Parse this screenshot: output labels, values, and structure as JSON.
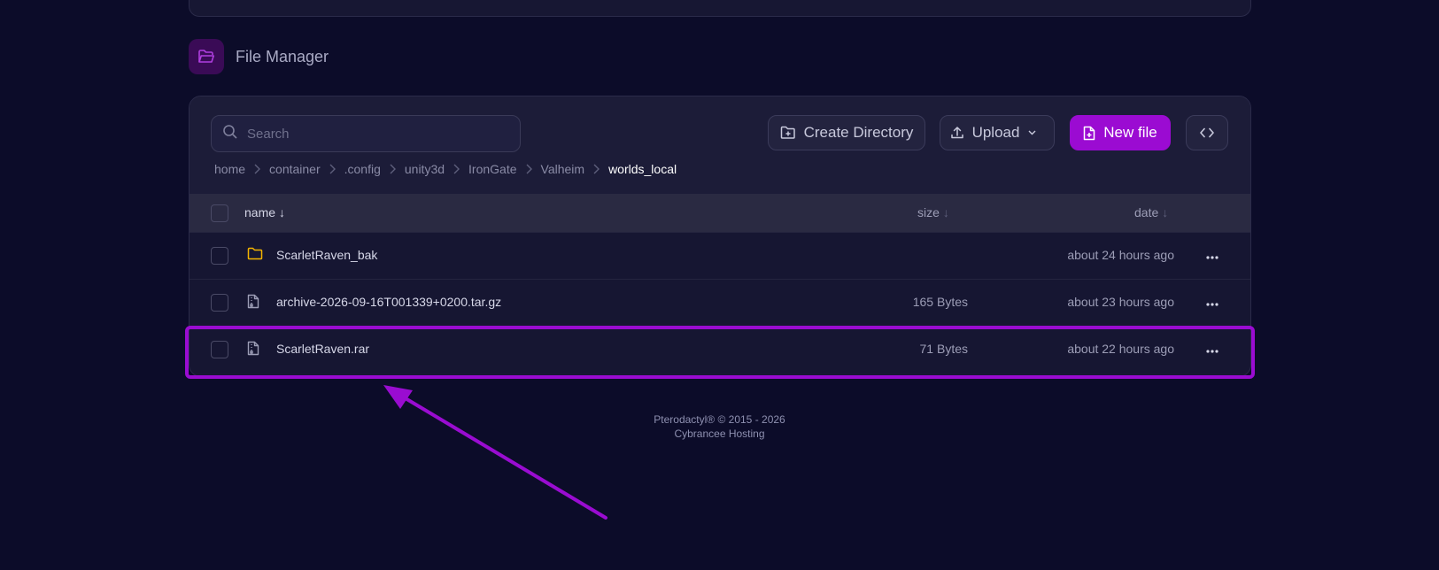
{
  "section": {
    "title": "File Manager",
    "icon": "folder-open-icon"
  },
  "toolbar": {
    "search_placeholder": "Search",
    "create_directory_label": "Create Directory",
    "upload_label": "Upload",
    "new_file_label": "New file"
  },
  "breadcrumb": {
    "items": [
      "home",
      "container",
      ".config",
      "unity3d",
      "IronGate",
      "Valheim"
    ],
    "current": "worlds_local"
  },
  "table": {
    "columns": {
      "name": "name",
      "size": "size",
      "date": "date"
    },
    "rows": [
      {
        "type": "folder",
        "name": "ScarletRaven_bak",
        "size": "",
        "date": "about 24 hours ago"
      },
      {
        "type": "file",
        "name": "archive-2026-09-16T001339+0200.tar.gz",
        "size": "165 Bytes",
        "date": "about 23 hours ago"
      },
      {
        "type": "file",
        "name": "ScarletRaven.rar",
        "size": "71 Bytes",
        "date": "about 22 hours ago"
      }
    ]
  },
  "footer": {
    "line1": "Pterodactyl® © 2015 - 2026",
    "line2": "Cybrancee Hosting"
  },
  "colors": {
    "accent": "#9b0bd2",
    "background": "#0c0c29",
    "panel": "#171733",
    "folder": "#f4b400"
  }
}
